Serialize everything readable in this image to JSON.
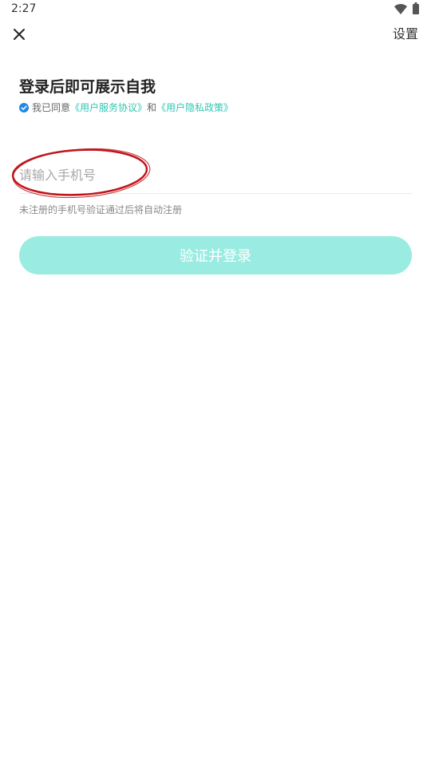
{
  "status_bar": {
    "time": "2:27",
    "wifi_icon": "wifi-icon",
    "battery_icon": "battery-icon"
  },
  "header": {
    "close_icon": "close-icon",
    "settings_label": "设置"
  },
  "login": {
    "title": "登录后即可展示自我",
    "agreement": {
      "checked": true,
      "prefix": "我已同意",
      "service_link": "《用户服务协议》",
      "conjunction": "和",
      "privacy_link": "《用户隐私政策》"
    },
    "phone_input": {
      "value": "",
      "placeholder": "请输入手机号"
    },
    "hint": "未注册的手机号验证通过后将自动注册",
    "submit_label": "验证并登录"
  },
  "colors": {
    "accent": "#2ec7b5",
    "button_bg": "#9aece2",
    "check": "#1e88e5",
    "annotation": "#c0141c"
  }
}
